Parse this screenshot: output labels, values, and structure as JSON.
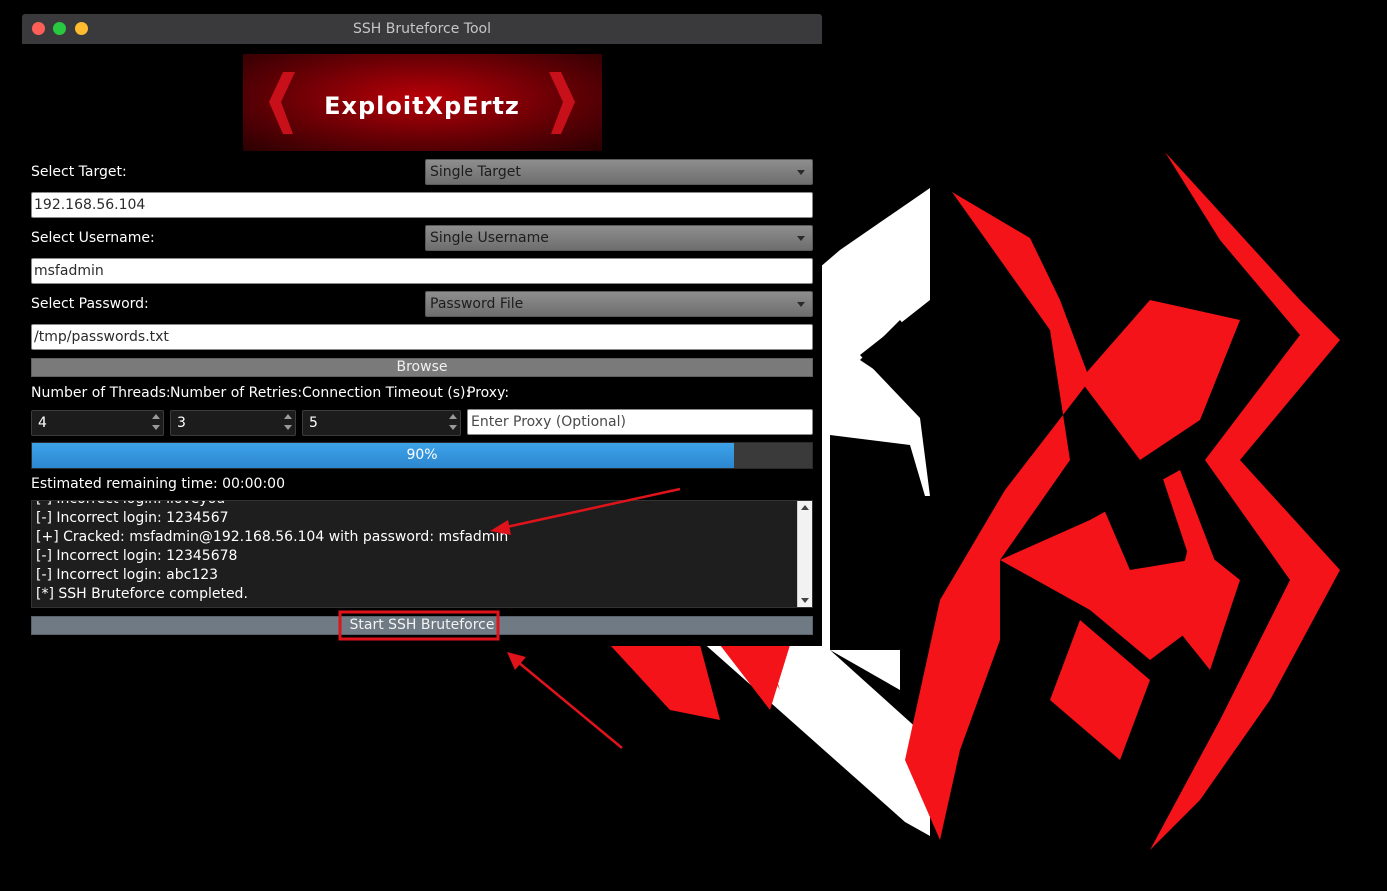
{
  "window": {
    "title": "SSH Bruteforce Tool"
  },
  "banner": {
    "text": "ExploitXpErtz"
  },
  "target": {
    "label": "Select Target:",
    "mode": "Single Target",
    "value": "192.168.56.104"
  },
  "username": {
    "label": "Select Username:",
    "mode": "Single Username",
    "value": "msfadmin"
  },
  "password": {
    "label": "Select Password:",
    "mode": "Password File",
    "value": "/tmp/passwords.txt",
    "browse_label": "Browse"
  },
  "options": {
    "threads_label": "Number of Threads:",
    "threads": "4",
    "retries_label": "Number of Retries:",
    "retries": "3",
    "timeout_label": "Connection Timeout (s):",
    "timeout": "5",
    "proxy_label": "Proxy:",
    "proxy_placeholder": "Enter Proxy (Optional)"
  },
  "progress": {
    "value": 0.9,
    "text": "90%"
  },
  "remaining": {
    "text": "Estimated remaining time: 00:00:00"
  },
  "log": {
    "lines": [
      "[-] Incorrect login: iloveyou",
      "[-] Incorrect login: 1234567",
      "[+] Cracked: msfadmin@192.168.56.104 with password: msfadmin",
      "[-] Incorrect login: 12345678",
      "[-] Incorrect login: abc123",
      "[*] SSH Bruteforce completed."
    ]
  },
  "start_button": {
    "label": "Start SSH Bruteforce"
  },
  "colors": {
    "accent_red": "#e8141c",
    "progress_blue": "#3a9be0",
    "annotation_red": "#e0131b"
  }
}
